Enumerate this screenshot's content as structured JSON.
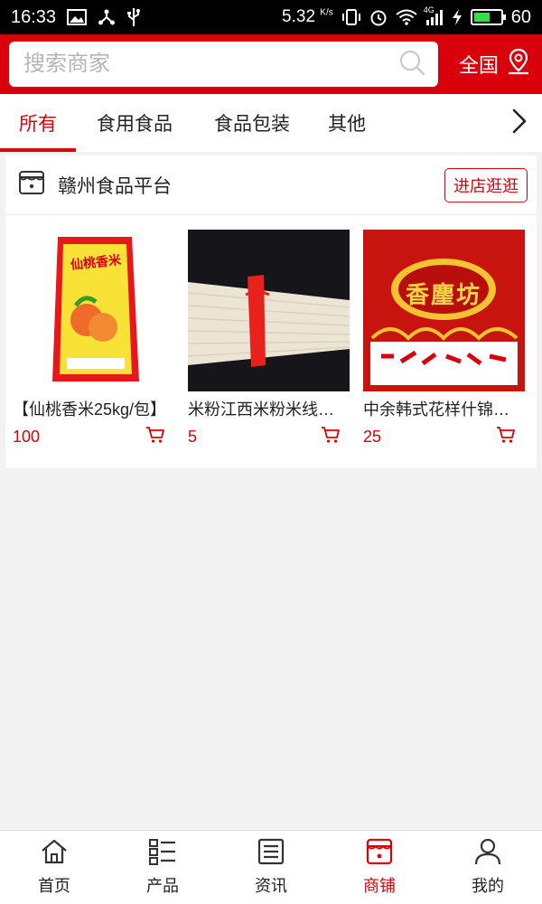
{
  "status_bar": {
    "time": "16:33",
    "speed": "5.32",
    "speed_unit": "K/s",
    "network": "4G",
    "battery": "60",
    "battery_level": 0.6
  },
  "header": {
    "search_placeholder": "搜索商家",
    "region_label": "全国",
    "icons": {
      "search": "search-icon",
      "location": "location-pin-icon"
    }
  },
  "tabs": [
    {
      "label": "所有",
      "active": true
    },
    {
      "label": "食用食品",
      "active": false
    },
    {
      "label": "食品包装",
      "active": false
    },
    {
      "label": "其他",
      "active": false
    }
  ],
  "shop": {
    "name": "赣州食品平台",
    "visit_label": "进店逛逛",
    "products": [
      {
        "title": "【仙桃香米25kg/包】",
        "price": "100",
        "image_text": "仙桃香米"
      },
      {
        "title": "米粉江西米粉米线面条",
        "price": "5"
      },
      {
        "title": "中余韩式花样什锦拉面",
        "price": "25",
        "image_text": "香麈坊"
      }
    ]
  },
  "bottom_nav": [
    {
      "label": "首页",
      "icon": "home-icon",
      "active": false
    },
    {
      "label": "产品",
      "icon": "list-icon",
      "active": false
    },
    {
      "label": "资讯",
      "icon": "news-icon",
      "active": false
    },
    {
      "label": "商铺",
      "icon": "shop-icon",
      "active": true
    },
    {
      "label": "我的",
      "icon": "user-icon",
      "active": false
    }
  ],
  "colors": {
    "accent": "#d9000b",
    "background": "#f2f2f2"
  }
}
